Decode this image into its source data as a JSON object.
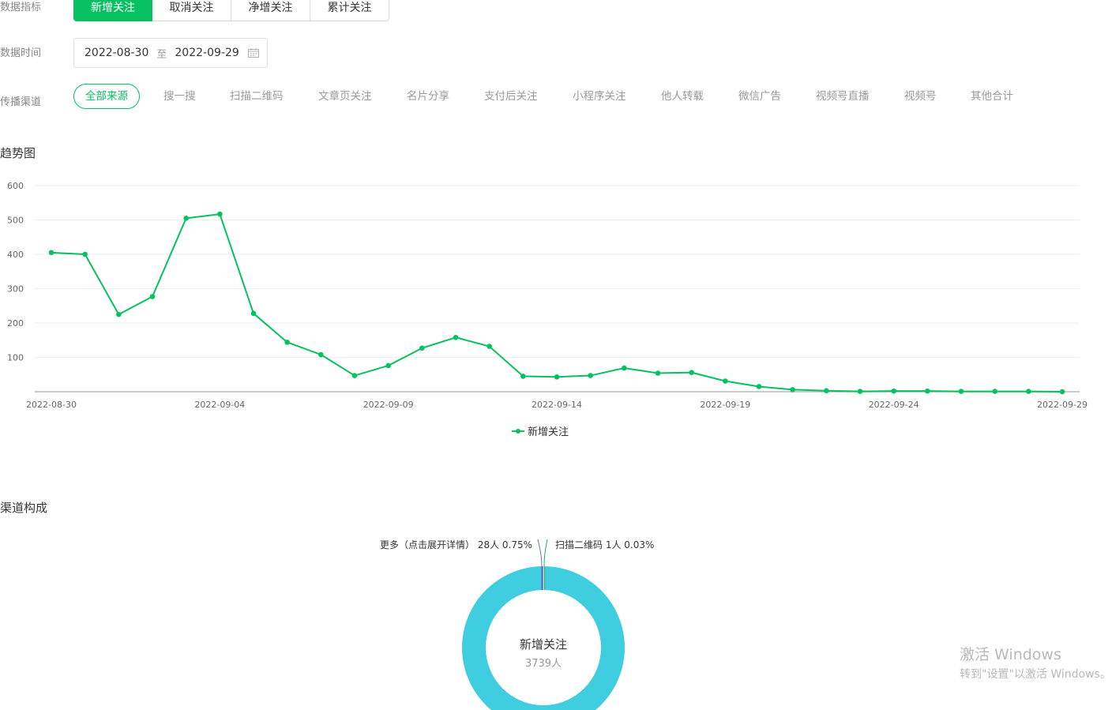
{
  "filters": {
    "metric_label": "数据指标",
    "metric_tabs": [
      "新增关注",
      "取消关注",
      "净增关注",
      "累计关注"
    ],
    "active_metric": 0,
    "time_label": "数据时间",
    "date_start": "2022-08-30",
    "date_sep": "至",
    "date_end": "2022-09-29",
    "channel_label": "传播渠道",
    "channels": [
      "全部来源",
      "搜一搜",
      "扫描二维码",
      "文章页关注",
      "名片分享",
      "支付后关注",
      "小程序关注",
      "他人转载",
      "微信广告",
      "视频号直播",
      "视频号",
      "其他合计"
    ],
    "active_channel": 0
  },
  "trend_title": "趋势图",
  "chart_data": {
    "type": "line",
    "x": [
      "2022-08-30",
      "2022-08-31",
      "2022-09-01",
      "2022-09-02",
      "2022-09-03",
      "2022-09-04",
      "2022-09-05",
      "2022-09-06",
      "2022-09-07",
      "2022-09-08",
      "2022-09-09",
      "2022-09-10",
      "2022-09-11",
      "2022-09-12",
      "2022-09-13",
      "2022-09-14",
      "2022-09-15",
      "2022-09-16",
      "2022-09-17",
      "2022-09-18",
      "2022-09-19",
      "2022-09-20",
      "2022-09-21",
      "2022-09-22",
      "2022-09-23",
      "2022-09-24",
      "2022-09-25",
      "2022-09-26",
      "2022-09-27",
      "2022-09-28",
      "2022-09-29"
    ],
    "series": [
      {
        "name": "新增关注",
        "color": "#07c160",
        "values": [
          405,
          400,
          225,
          277,
          505,
          517,
          228,
          144,
          108,
          47,
          76,
          127,
          158,
          132,
          45,
          43,
          47,
          69,
          54,
          56,
          31,
          15,
          6,
          3,
          1,
          2,
          2,
          1,
          1,
          1,
          0
        ]
      }
    ],
    "xticks": [
      "2022-08-30",
      "2022-09-04",
      "2022-09-09",
      "2022-09-14",
      "2022-09-19",
      "2022-09-24",
      "2022-09-29"
    ],
    "yticks": [
      100,
      200,
      300,
      400,
      500,
      600
    ],
    "ylim": [
      0,
      600
    ],
    "grid": true,
    "legend": "bottom-center"
  },
  "composition_title": "渠道构成",
  "donut": {
    "center_title": "新增关注",
    "center_value": "3739人",
    "main_color": "#3fcde0",
    "labels": [
      {
        "text": "更多（点击展开详情）  28人 0.75%",
        "color": "#6f6ec9"
      },
      {
        "text": "扫描二维码  1人 0.03%",
        "color": "#07c160"
      }
    ]
  },
  "watermark": {
    "line1": "激活 Windows",
    "line2": "转到\"设置\"以激活 Windows。"
  }
}
